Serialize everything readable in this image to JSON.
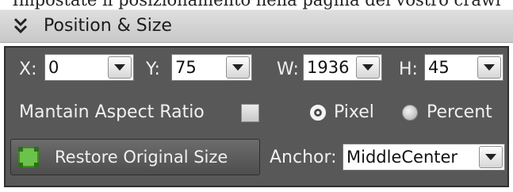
{
  "caption": "Impostate il posizionamento nella pagina del vostro crawl",
  "header": {
    "title": "Position & Size",
    "collapse_icon": "double-chevron-down-icon"
  },
  "fields": {
    "x": {
      "label": "X:",
      "value": "0"
    },
    "y": {
      "label": "Y:",
      "value": "75"
    },
    "w": {
      "label": "W:",
      "value": "1936"
    },
    "h": {
      "label": "H:",
      "value": "45"
    }
  },
  "aspect": {
    "label": "Mantain Aspect Ratio",
    "checked": false
  },
  "units": {
    "pixel_label": "Pixel",
    "percent_label": "Percent",
    "selected": "Pixel"
  },
  "restore_button": {
    "label": "Restore Original Size",
    "icon": "resize-icon"
  },
  "anchor": {
    "label": "Anchor:",
    "value": "MiddleCenter"
  },
  "colors": {
    "panel_background": "#585858",
    "header_background": "#d4d4d4",
    "accent_green": "#6cc24a"
  }
}
